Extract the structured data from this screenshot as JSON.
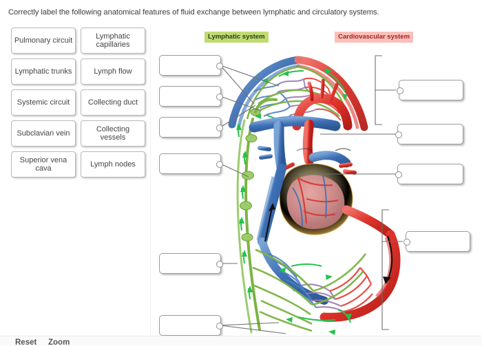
{
  "instruction": "Correctly label the following anatomical features of fluid exchange between lymphatic and circulatory systems.",
  "word_bank": {
    "rows": [
      [
        {
          "label": "Pulmonary circuit"
        },
        {
          "label": "Lymphatic capillaries"
        }
      ],
      [
        {
          "label": "Lymphatic trunks"
        },
        {
          "label": "Lymph flow"
        }
      ],
      [
        {
          "label": "Systemic circuit"
        },
        {
          "label": "Collecting duct"
        }
      ],
      [
        {
          "label": "Subclavian vein"
        },
        {
          "label": "Collecting vessels"
        }
      ],
      [
        {
          "label": "Superior vena cava"
        },
        {
          "label": "Lymph nodes"
        }
      ]
    ]
  },
  "diagram": {
    "headers": [
      {
        "name": "lymphatic-system-header",
        "label": "Lymphatic system",
        "bg": "#c2da74",
        "color": "#23420a"
      },
      {
        "name": "cardiovascular-system-header",
        "label": "Cardiovascular system",
        "bg": "#fbc0bb",
        "color": "#a2221c"
      }
    ],
    "answer_boxes": [
      {
        "id": "left-1",
        "value": "",
        "placeholder": ""
      },
      {
        "id": "left-2",
        "value": "",
        "placeholder": ""
      },
      {
        "id": "left-3",
        "value": "",
        "placeholder": ""
      },
      {
        "id": "left-4",
        "value": "",
        "placeholder": ""
      },
      {
        "id": "left-5",
        "value": "",
        "placeholder": ""
      },
      {
        "id": "left-6",
        "value": "",
        "placeholder": ""
      },
      {
        "id": "right-1",
        "value": "",
        "placeholder": ""
      },
      {
        "id": "right-2",
        "value": "",
        "placeholder": ""
      },
      {
        "id": "right-3",
        "value": "",
        "placeholder": ""
      },
      {
        "id": "right-4",
        "value": "",
        "placeholder": ""
      }
    ],
    "colors": {
      "lymphatic_vessel": "#7cb342",
      "lymph_arrow": "#22c24a",
      "vein_blue": "#4a7fc1",
      "artery_red": "#e23b33",
      "capillary_purple": "#9a7ab0",
      "heart_fat": "#e8c46a",
      "leader_line": "#6f6f6f"
    }
  },
  "toolbar": {
    "reset_label": "Reset",
    "zoom_label": "Zoom"
  }
}
